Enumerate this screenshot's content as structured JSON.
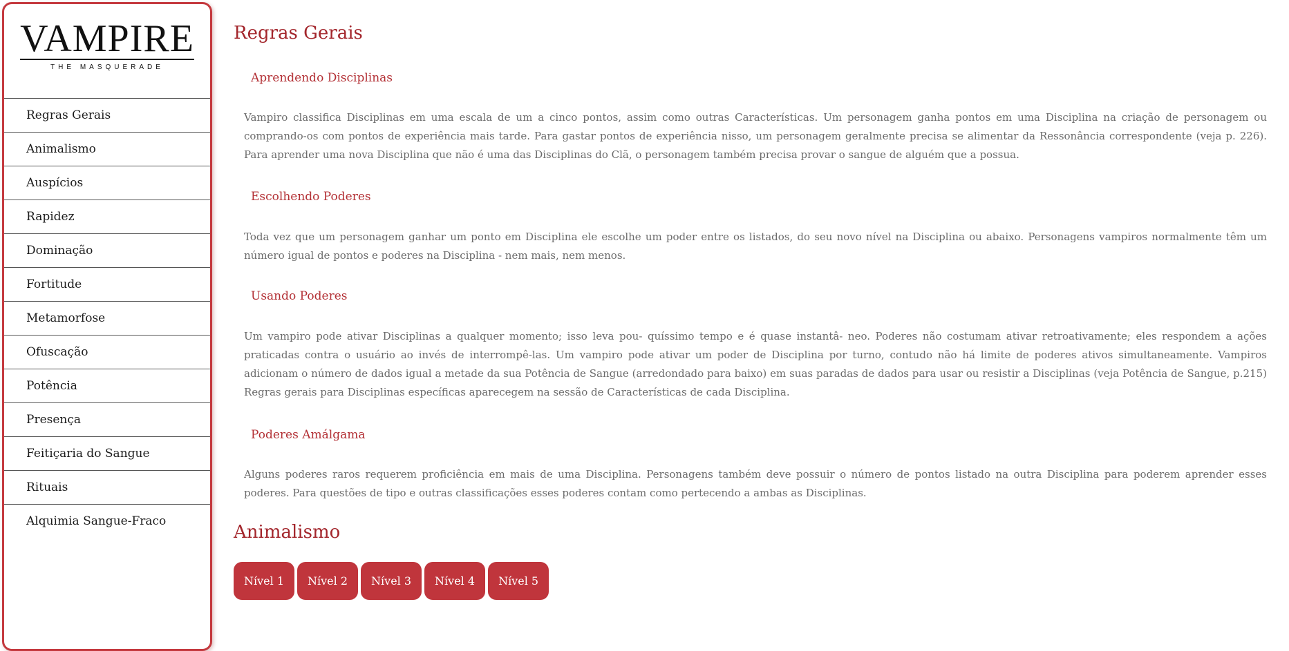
{
  "logo": {
    "main_text": "VAMPIRE",
    "sub_text": "THE MASQUERADE"
  },
  "sidebar": {
    "items": [
      {
        "label": "Regras Gerais"
      },
      {
        "label": "Animalismo"
      },
      {
        "label": "Auspícios"
      },
      {
        "label": "Rapidez"
      },
      {
        "label": "Dominação"
      },
      {
        "label": "Fortitude"
      },
      {
        "label": "Metamorfose"
      },
      {
        "label": "Ofuscação"
      },
      {
        "label": "Potência"
      },
      {
        "label": "Presença"
      },
      {
        "label": "Feitiçaria do Sangue"
      },
      {
        "label": "Rituais"
      },
      {
        "label": "Alquimia Sangue-Fraco"
      }
    ]
  },
  "main": {
    "regras_title": "Regras Gerais",
    "sections": [
      {
        "title": "Aprendendo Disciplinas",
        "text": "Vampiro classifica Disciplinas em uma escala de um a cinco pontos, assim como outras Características. Um personagem ganha pontos em uma Disciplina na criação de personagem ou comprando-os com pontos de experiência mais tarde. Para gastar pontos de experiência nisso, um personagem geralmente precisa se alimentar da Ressonância correspondente (veja p. 226). Para aprender uma nova Disciplina que não é uma das Disciplinas do Clã, o personagem também precisa provar o sangue de alguém que a possua."
      },
      {
        "title": "Escolhendo Poderes",
        "text": "Toda vez que um personagem ganhar um ponto em Disciplina ele escolhe um poder entre os listados, do seu novo nível na Disciplina ou abaixo. Personagens vampiros normalmente têm um número igual de pontos e poderes na Disciplina - nem mais, nem menos."
      },
      {
        "title": "Usando Poderes",
        "text": "Um vampiro pode ativar Disciplinas a qualquer momento; isso leva pou- quíssimo tempo e é quase instantâ- neo. Poderes não costumam ativar retroativamente; eles respondem a ações praticadas contra o usuário ao invés de interrompê-las. Um vampiro pode ativar um poder de Disciplina por turno, contudo não há limite de poderes ativos simultaneamente. Vampiros adicionam o número de dados igual a metade da sua Potência de Sangue (arredondado para baixo) em suas paradas de dados para usar ou resistir a Disciplinas (veja Potência de Sangue, p.215) Regras gerais para Disciplinas específicas aparecegem na sessão de Características de cada Disciplina."
      },
      {
        "title": "Poderes Amálgama",
        "text": "Alguns poderes raros requerem proficiência em mais de uma Disciplina. Personagens também deve possuir o número de pontos listado na outra Disciplina para poderem aprender esses poderes. Para questões de tipo e outras classificações esses poderes contam como pertecendo a ambas as Disciplinas."
      }
    ],
    "animalismo_title": "Animalismo",
    "levels": [
      "Nível 1",
      "Nível 2",
      "Nível 3",
      "Nível 4",
      "Nível 5"
    ]
  },
  "colors": {
    "accent": "#c0353c",
    "title": "#a3262c",
    "body_text": "#6b6b6b"
  }
}
